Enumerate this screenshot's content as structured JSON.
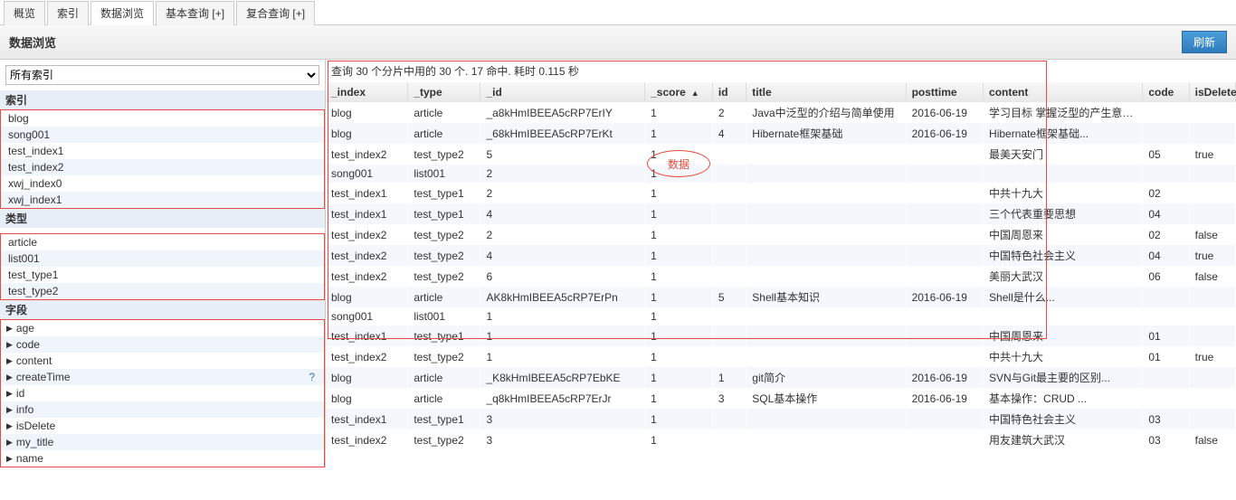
{
  "tabs": {
    "overview": "概览",
    "index": "索引",
    "browse": "数据浏览",
    "basic": "基本查询 [+]",
    "compound": "复合查询 [+]"
  },
  "header": {
    "title": "数据浏览",
    "refresh": "刷新"
  },
  "sidebar": {
    "all_indices": "所有索引",
    "section_index": "索引",
    "indices": [
      "blog",
      "song001",
      "test_index1",
      "test_index2",
      "xwj_index0",
      "xwj_index1"
    ],
    "section_type": "类型",
    "types": [
      "article",
      "list001",
      "test_type1",
      "test_type2"
    ],
    "section_field": "字段",
    "fields": [
      "age",
      "code",
      "content",
      "createTime",
      "id",
      "info",
      "isDelete",
      "my_title",
      "name"
    ]
  },
  "status": "查询 30 个分片中用的 30 个. 17 命中. 耗时 0.115 秒",
  "columns": [
    "_index",
    "_type",
    "_id",
    "_score",
    "id",
    "title",
    "posttime",
    "content",
    "code",
    "isDelete"
  ],
  "rows": [
    {
      "_index": "blog",
      "_type": "article",
      "_id": "_a8kHmIBEEA5cRP7ErIY",
      "_score": "1",
      "id": "2",
      "title": "Java中泛型的介绍与简单使用",
      "posttime": "2016-06-19",
      "content": "学习目标 掌握泛型的产生意义...",
      "code": "",
      "isDelete": ""
    },
    {
      "_index": "blog",
      "_type": "article",
      "_id": "_68kHmIBEEA5cRP7ErKt",
      "_score": "1",
      "id": "4",
      "title": "Hibernate框架基础",
      "posttime": "2016-06-19",
      "content": "Hibernate框架基础...",
      "code": "",
      "isDelete": ""
    },
    {
      "_index": "test_index2",
      "_type": "test_type2",
      "_id": "5",
      "_score": "1",
      "id": "",
      "title": "",
      "posttime": "",
      "content": "最美天安门",
      "code": "05",
      "isDelete": "true"
    },
    {
      "_index": "song001",
      "_type": "list001",
      "_id": "2",
      "_score": "1",
      "id": "",
      "title": "",
      "posttime": "",
      "content": "",
      "code": "",
      "isDelete": ""
    },
    {
      "_index": "test_index1",
      "_type": "test_type1",
      "_id": "2",
      "_score": "1",
      "id": "",
      "title": "",
      "posttime": "",
      "content": "中共十九大",
      "code": "02",
      "isDelete": ""
    },
    {
      "_index": "test_index1",
      "_type": "test_type1",
      "_id": "4",
      "_score": "1",
      "id": "",
      "title": "",
      "posttime": "",
      "content": "三个代表重要思想",
      "code": "04",
      "isDelete": ""
    },
    {
      "_index": "test_index2",
      "_type": "test_type2",
      "_id": "2",
      "_score": "1",
      "id": "",
      "title": "",
      "posttime": "",
      "content": "中国周恩来",
      "code": "02",
      "isDelete": "false"
    },
    {
      "_index": "test_index2",
      "_type": "test_type2",
      "_id": "4",
      "_score": "1",
      "id": "",
      "title": "",
      "posttime": "",
      "content": "中国特色社会主义",
      "code": "04",
      "isDelete": "true"
    },
    {
      "_index": "test_index2",
      "_type": "test_type2",
      "_id": "6",
      "_score": "1",
      "id": "",
      "title": "",
      "posttime": "",
      "content": "美丽大武汉",
      "code": "06",
      "isDelete": "false"
    },
    {
      "_index": "blog",
      "_type": "article",
      "_id": "AK8kHmIBEEA5cRP7ErPn",
      "_score": "1",
      "id": "5",
      "title": "Shell基本知识",
      "posttime": "2016-06-19",
      "content": "Shell是什么...",
      "code": "",
      "isDelete": ""
    },
    {
      "_index": "song001",
      "_type": "list001",
      "_id": "1",
      "_score": "1",
      "id": "",
      "title": "",
      "posttime": "",
      "content": "",
      "code": "",
      "isDelete": ""
    },
    {
      "_index": "test_index1",
      "_type": "test_type1",
      "_id": "1",
      "_score": "1",
      "id": "",
      "title": "",
      "posttime": "",
      "content": "中国周恩来",
      "code": "01",
      "isDelete": ""
    },
    {
      "_index": "test_index2",
      "_type": "test_type2",
      "_id": "1",
      "_score": "1",
      "id": "",
      "title": "",
      "posttime": "",
      "content": "中共十九大",
      "code": "01",
      "isDelete": "true"
    },
    {
      "_index": "blog",
      "_type": "article",
      "_id": "_K8kHmIBEEA5cRP7EbKE",
      "_score": "1",
      "id": "1",
      "title": "git简介",
      "posttime": "2016-06-19",
      "content": "SVN与Git最主要的区别...",
      "code": "",
      "isDelete": ""
    },
    {
      "_index": "blog",
      "_type": "article",
      "_id": "_q8kHmIBEEA5cRP7ErJr",
      "_score": "1",
      "id": "3",
      "title": "SQL基本操作",
      "posttime": "2016-06-19",
      "content": "基本操作：CRUD ...",
      "code": "",
      "isDelete": ""
    },
    {
      "_index": "test_index1",
      "_type": "test_type1",
      "_id": "3",
      "_score": "1",
      "id": "",
      "title": "",
      "posttime": "",
      "content": "中国特色社会主义",
      "code": "03",
      "isDelete": ""
    },
    {
      "_index": "test_index2",
      "_type": "test_type2",
      "_id": "3",
      "_score": "1",
      "id": "",
      "title": "",
      "posttime": "",
      "content": "用友建筑大武汉",
      "code": "03",
      "isDelete": "false"
    }
  ],
  "annotation": {
    "data_label": "数据"
  }
}
